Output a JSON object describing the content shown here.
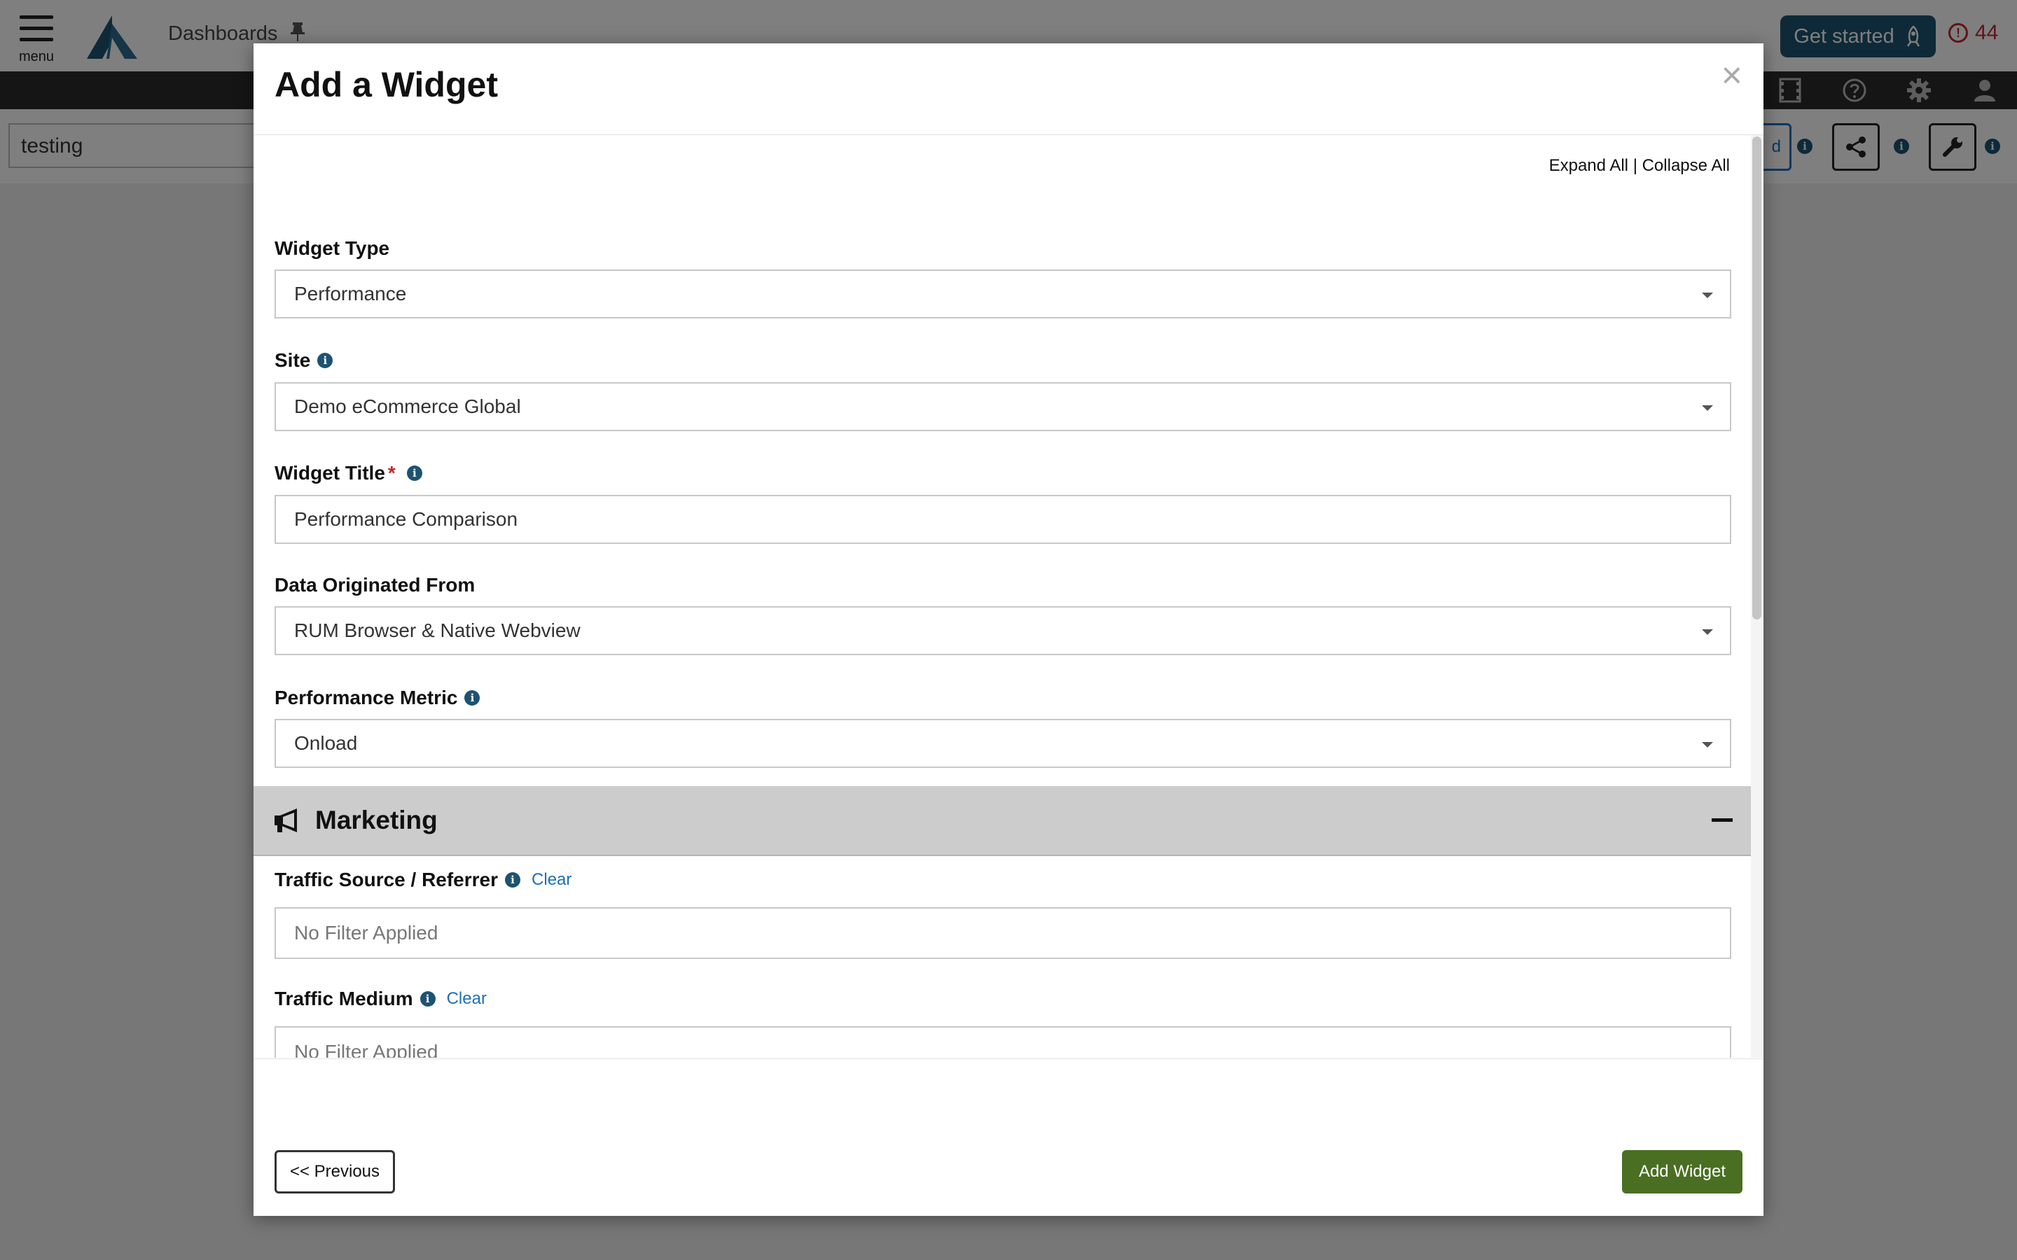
{
  "app": {
    "menu_label": "menu",
    "title": "Dashboards",
    "get_started_label": "Get started",
    "alerts_count": "44",
    "dashboard_name": "testing",
    "add_button_fragment": "d"
  },
  "modal": {
    "title": "Add a Widget",
    "close_symbol": "×",
    "expand_all": "Expand All",
    "separator": "|",
    "collapse_all": "Collapse All",
    "fields": {
      "widget_type": {
        "label": "Widget Type",
        "value": "Performance"
      },
      "site": {
        "label": "Site",
        "value": "Demo eCommerce Global"
      },
      "widget_title": {
        "label": "Widget Title",
        "required_mark": "*",
        "value": "Performance Comparison"
      },
      "data_origin": {
        "label": "Data Originated From",
        "value": "RUM Browser & Native Webview"
      },
      "performance_metric": {
        "label": "Performance Metric",
        "value": "Onload"
      }
    },
    "marketing_section": {
      "title": "Marketing",
      "traffic_source": {
        "label": "Traffic Source / Referrer",
        "clear_label": "Clear",
        "placeholder": "No Filter Applied"
      },
      "traffic_medium": {
        "label": "Traffic Medium",
        "clear_label": "Clear",
        "placeholder": "No Filter Applied"
      }
    },
    "footer": {
      "previous_label": "<< Previous",
      "add_widget_label": "Add Widget"
    }
  },
  "colors": {
    "brand_navy": "#1d5371",
    "alert_red": "#c0282d",
    "link_blue": "#1d6fb8",
    "add_button_green": "#4a6e22"
  }
}
